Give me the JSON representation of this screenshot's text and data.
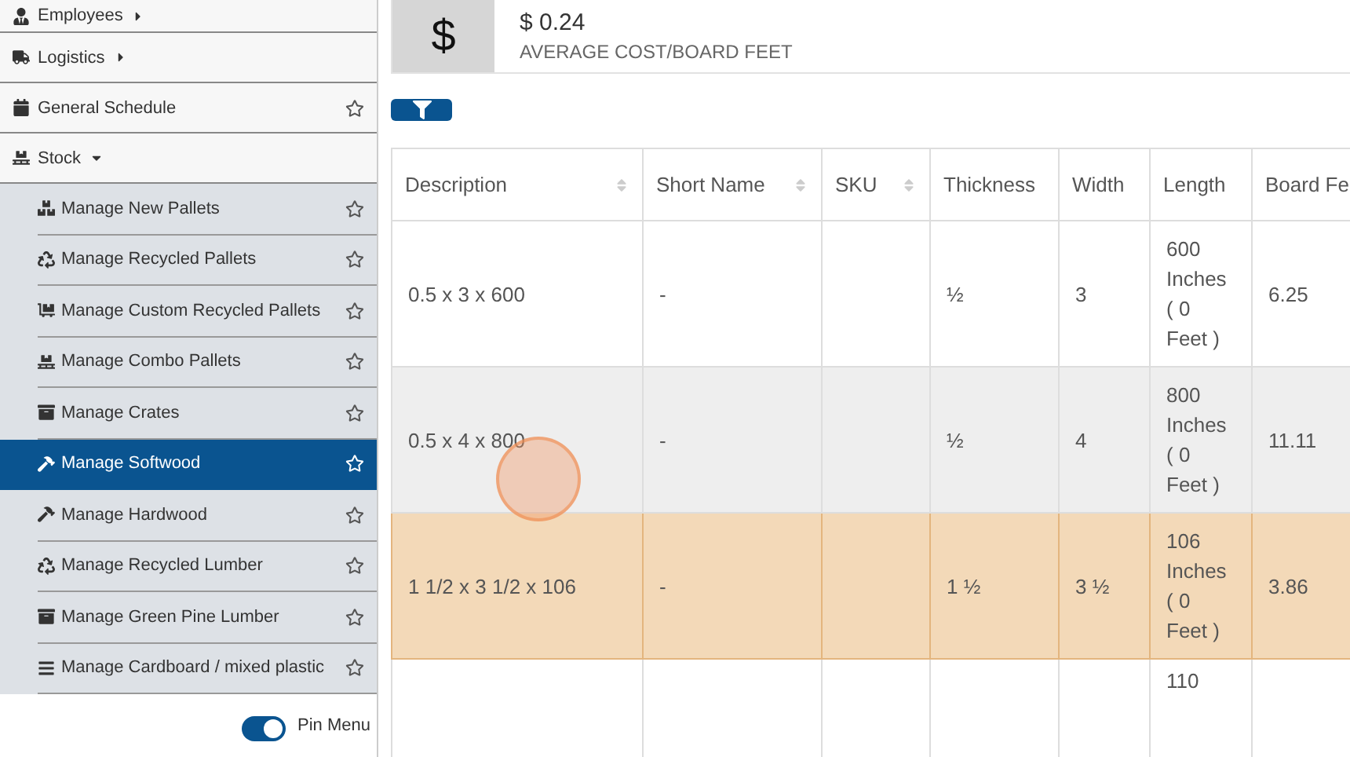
{
  "sidebar": {
    "items": [
      {
        "label": "Employees",
        "kind": "menu",
        "expanded": false
      },
      {
        "label": "Logistics",
        "kind": "menu",
        "expanded": false
      },
      {
        "label": "General Schedule",
        "kind": "link"
      },
      {
        "label": "Stock",
        "kind": "menu",
        "expanded": true,
        "children": [
          {
            "label": "Manage New Pallets",
            "selected": false
          },
          {
            "label": "Manage Recycled Pallets",
            "selected": false
          },
          {
            "label": "Manage Custom Recycled Pallets",
            "selected": false
          },
          {
            "label": "Manage Combo Pallets",
            "selected": false
          },
          {
            "label": "Manage Crates",
            "selected": false
          },
          {
            "label": "Manage Softwood",
            "selected": true
          },
          {
            "label": "Manage Hardwood",
            "selected": false
          },
          {
            "label": "Manage Recycled Lumber",
            "selected": false
          },
          {
            "label": "Manage Green Pine Lumber",
            "selected": false
          },
          {
            "label": "Manage Cardboard / mixed plastic",
            "selected": false
          }
        ]
      }
    ],
    "pin_menu": {
      "label": "Pin Menu",
      "on": true
    }
  },
  "stat_card": {
    "symbol": "$",
    "value": "$ 0.24",
    "label": "AVERAGE COST/BOARD FEET"
  },
  "table": {
    "columns": [
      {
        "label": "Description",
        "sortable": true
      },
      {
        "label": "Short Name",
        "sortable": true
      },
      {
        "label": "SKU",
        "sortable": true
      },
      {
        "label": "Thickness",
        "sortable": false
      },
      {
        "label": "Width",
        "sortable": false
      },
      {
        "label": "Length",
        "sortable": false
      },
      {
        "label": "Board Fe"
      }
    ],
    "rows": [
      {
        "hovered": false,
        "highlighted": false,
        "cells": [
          "0.5 x 3 x 600",
          "-",
          "",
          "½",
          "3",
          "600 Inches ( 0 Feet )",
          "6.25"
        ]
      },
      {
        "hovered": true,
        "highlighted": false,
        "cells": [
          "0.5 x 4 x 800",
          "-",
          "",
          "½",
          "4",
          "800 Inches ( 0 Feet )",
          "11.11"
        ]
      },
      {
        "hovered": false,
        "highlighted": true,
        "cells": [
          "1 1/2 x 3 1/2 x 106",
          "-",
          "",
          "1 ½",
          "3 ½",
          "106 Inches ( 0 Feet )",
          "3.86"
        ]
      },
      {
        "hovered": false,
        "highlighted": false,
        "cells": [
          "",
          "",
          "",
          "",
          "",
          "110",
          ""
        ]
      }
    ]
  }
}
